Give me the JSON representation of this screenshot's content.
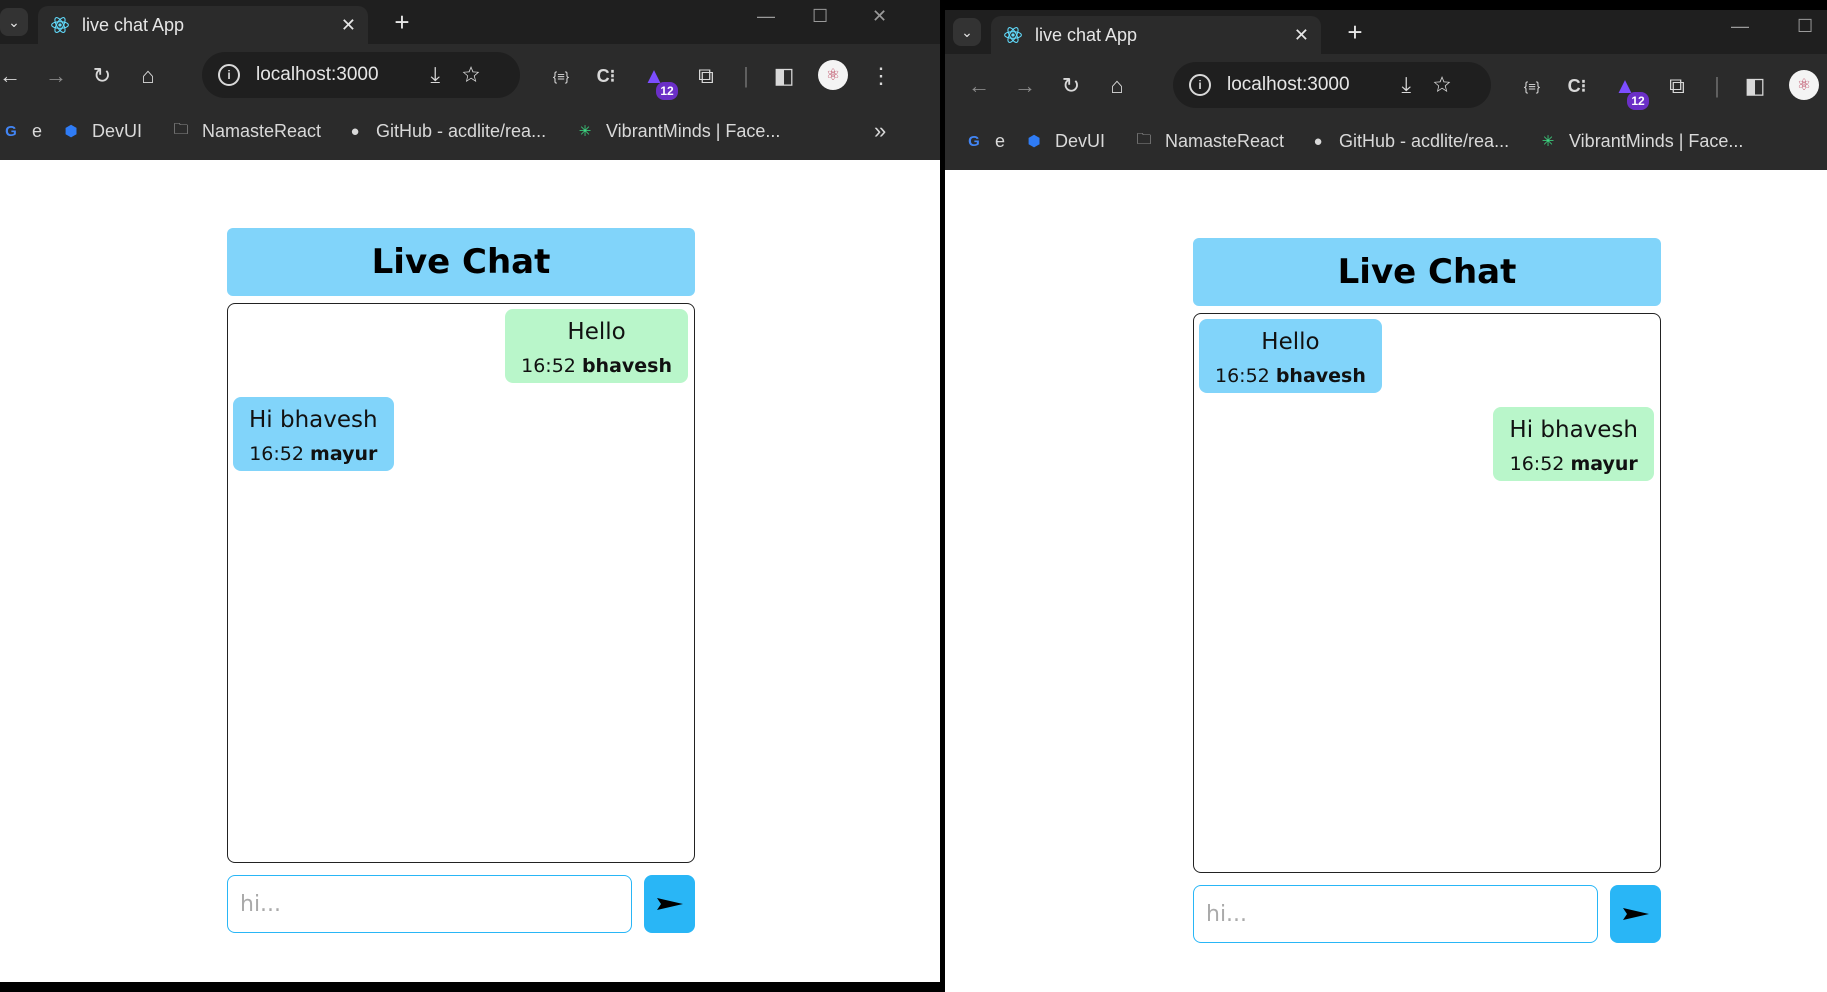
{
  "browser": {
    "tab_title": "live chat App",
    "tab_close": "✕",
    "new_tab": "+",
    "url": "localhost:3000",
    "extension_badge": "12",
    "bookmarks": [
      {
        "label": "e",
        "icon": "google-icon"
      },
      {
        "label": "DevUI",
        "icon": "devui-icon"
      },
      {
        "label": "NamasteReact",
        "icon": "folder-icon"
      },
      {
        "label": "GitHub - acdlite/rea...",
        "icon": "github-icon"
      },
      {
        "label": "VibrantMinds | Face...",
        "icon": "vibrantminds-icon"
      }
    ]
  },
  "chat": {
    "title": "Live Chat",
    "placeholder": "hi...",
    "send_icon": "send-arrow-icon"
  },
  "left_window": {
    "messages": [
      {
        "text": "Hello",
        "time": "16:52",
        "user": "bhavesh",
        "side": "sent"
      },
      {
        "text": "Hi bhavesh",
        "time": "16:52",
        "user": "mayur",
        "side": "received"
      }
    ]
  },
  "right_window": {
    "messages": [
      {
        "text": "Hello",
        "time": "16:52",
        "user": "bhavesh",
        "side": "received"
      },
      {
        "text": "Hi bhavesh",
        "time": "16:52",
        "user": "mayur",
        "side": "sent"
      }
    ]
  },
  "colors": {
    "header": "#81d4fa",
    "sent_bubble": "#b9f6ca",
    "received_bubble": "#81d4fa",
    "send_button": "#29b6f6"
  }
}
